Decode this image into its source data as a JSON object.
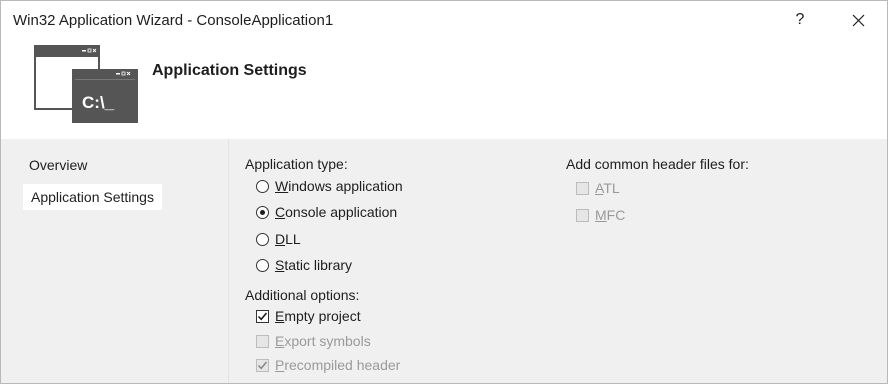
{
  "window": {
    "title": "Win32 Application Wizard - ConsoleApplication1",
    "help_label": "?",
    "close_label": "close"
  },
  "header": {
    "title": "Application Settings",
    "icon": "console-window-icon",
    "icon_text": "C:\\_"
  },
  "nav": {
    "items": [
      {
        "label": "Overview",
        "selected": false
      },
      {
        "label": "Application Settings",
        "selected": true
      }
    ]
  },
  "application_type": {
    "label": "Application type:",
    "options": [
      {
        "mnemonic": "W",
        "rest": "indows application",
        "selected": false
      },
      {
        "mnemonic": "C",
        "rest": "onsole application",
        "selected": true
      },
      {
        "mnemonic": "D",
        "rest": "LL",
        "selected": false
      },
      {
        "mnemonic": "S",
        "rest": "tatic library",
        "selected": false
      }
    ]
  },
  "additional_options": {
    "label": "Additional options:",
    "options": [
      {
        "mnemonic": "E",
        "rest": "mpty project",
        "checked": true,
        "enabled": true
      },
      {
        "mnemonic": "E",
        "rest": "xport symbols",
        "checked": false,
        "enabled": false
      },
      {
        "mnemonic": "P",
        "rest": "recompiled header",
        "checked": true,
        "enabled": false
      }
    ]
  },
  "common_headers": {
    "label": "Add common header files for:",
    "options": [
      {
        "mnemonic": "A",
        "rest": "TL",
        "checked": false,
        "enabled": false
      },
      {
        "mnemonic": "M",
        "rest": "FC",
        "checked": false,
        "enabled": false
      }
    ]
  },
  "colors": {
    "panel_bg": "#f0f0f0",
    "icon_dark": "#555555",
    "disabled_text": "#9a9a9a"
  }
}
